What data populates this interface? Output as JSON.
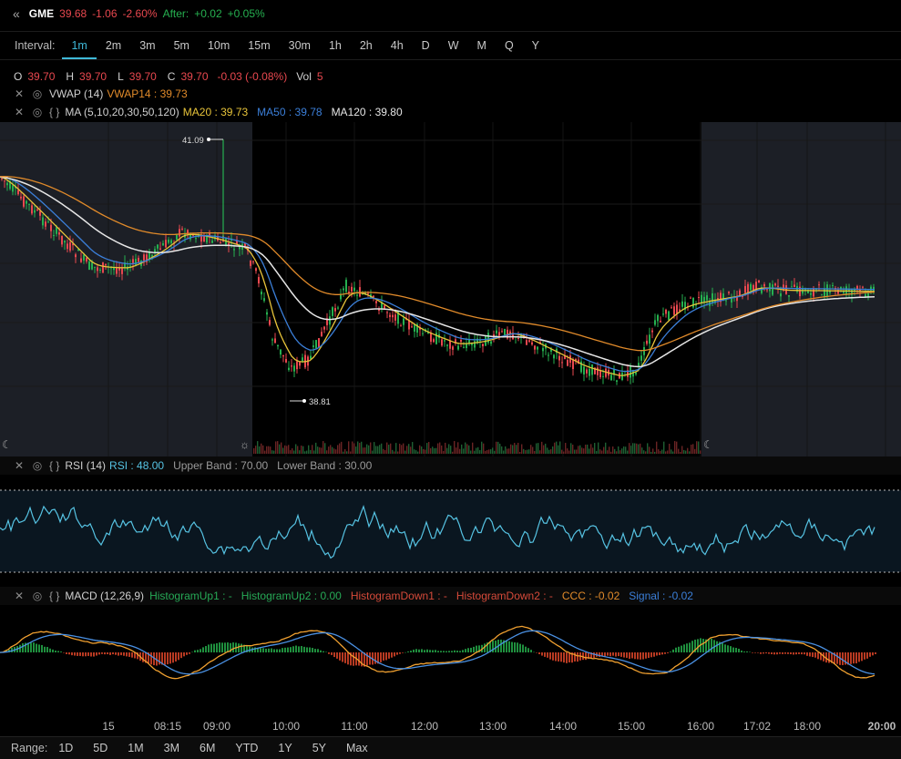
{
  "header": {
    "back_icon": "double-chevron-left-icon",
    "symbol": "GME",
    "price": "39.68",
    "change": "-1.06",
    "change_pct": "-2.60%",
    "after_label": "After:",
    "after_change": "+0.02",
    "after_pct": "+0.05%"
  },
  "interval": {
    "label": "Interval:",
    "options": [
      "1m",
      "2m",
      "3m",
      "5m",
      "10m",
      "15m",
      "30m",
      "1h",
      "2h",
      "4h",
      "D",
      "W",
      "M",
      "Q",
      "Y"
    ],
    "selected": "1m"
  },
  "ohlc": {
    "o_label": "O",
    "o": "39.70",
    "h_label": "H",
    "h": "39.70",
    "l_label": "L",
    "l": "39.70",
    "c_label": "C",
    "c": "39.70",
    "chg": "-0.03 (-0.08%)",
    "vol_label": "Vol",
    "vol": "5"
  },
  "vwap": {
    "name": "VWAP (14)",
    "value": "VWAP14 : 39.73"
  },
  "ma": {
    "braces": "{ }",
    "name": "MA (5,10,20,30,50,120)",
    "ma20": "MA20 : 39.73",
    "ma50": "MA50 : 39.78",
    "ma120": "MA120 : 39.80"
  },
  "price_chart": {
    "high_label": "41.09",
    "low_label": "38.81"
  },
  "rsi": {
    "braces": "{ }",
    "name": "RSI (14)",
    "value": "RSI : 48.00",
    "upper": "Upper Band : 70.00",
    "lower": "Lower Band : 30.00"
  },
  "macd": {
    "braces": "{ }",
    "name": "MACD (12,26,9)",
    "hup1": "HistogramUp1 : -",
    "hup2": "HistogramUp2 : 0.00",
    "hdown1": "HistogramDown1 : -",
    "hdown2": "HistogramDown2 : -",
    "ccc": "CCC : -0.02",
    "signal": "Signal : -0.02"
  },
  "x_axis": {
    "ticks": [
      "15",
      "08:15",
      "09:00",
      "10:00",
      "11:00",
      "12:00",
      "13:00",
      "14:00",
      "15:00",
      "16:00",
      "17:02",
      "18:00",
      "20:00"
    ]
  },
  "range": {
    "label": "Range:",
    "options": [
      "1D",
      "5D",
      "1M",
      "3M",
      "6M",
      "YTD",
      "1Y",
      "5Y",
      "Max"
    ]
  },
  "colors": {
    "accent": "#3fb9d9",
    "down": "#e8484f",
    "up": "#26b050",
    "ma20": "#e8c43a",
    "ma50": "#3b7fd9",
    "ma120": "#e6e6e6",
    "vwap": "#e08a2a",
    "rsi": "#56c3e3"
  }
}
